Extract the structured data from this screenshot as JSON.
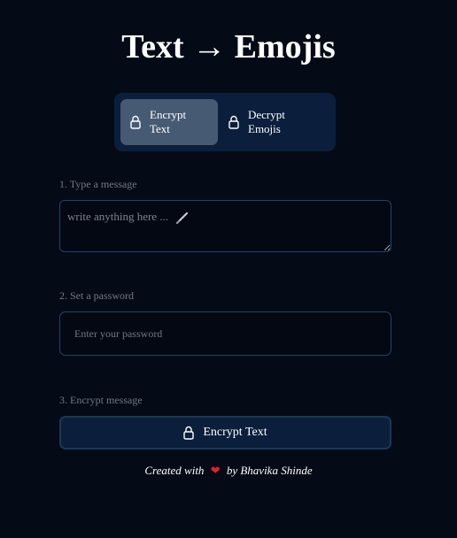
{
  "header": {
    "title": "Text → Emojis"
  },
  "mode_switch": {
    "encrypt_label": "Encrypt Text",
    "decrypt_label": "Decrypt Emojis",
    "active": "encrypt"
  },
  "steps": {
    "message_label": "1. Type a message",
    "message_placeholder": "write anything here ...",
    "password_label": "2. Set a password",
    "password_placeholder": "Enter your password",
    "encrypt_label": "3. Encrypt message"
  },
  "action": {
    "encrypt_button_label": "Encrypt Text"
  },
  "footer": {
    "prefix": "Created with",
    "suffix": "by Bhavika Shinde"
  },
  "icons": {
    "mode_encrypt": "lock-icon",
    "mode_decrypt": "lock-icon",
    "placeholder_emoji": "pencil-icon",
    "button": "lock-icon",
    "footer": "heart-icon"
  },
  "colors": {
    "background": "#040b16",
    "panel": "#0b1f3c",
    "active_tab": "#475a74",
    "border": "#25426a",
    "heart": "#e0212b"
  }
}
